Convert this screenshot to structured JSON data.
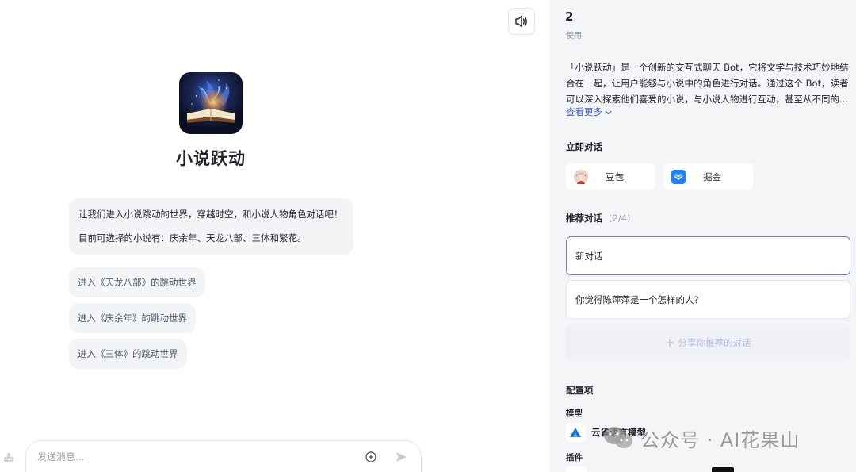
{
  "chat": {
    "bot_name": "小说跃动",
    "welcome_lines": [
      "让我们进入小说跳动的世界，穿越时空，和小说人物角色对话吧！",
      "目前可选择的小说有：庆余年、天龙八部、三体和繁花。"
    ],
    "suggestions": [
      "进入《天龙八部》的跳动世界",
      "进入《庆余年》的跳动世界",
      "进入《三体》的跳动世界"
    ],
    "composer_placeholder": "发送消息..."
  },
  "panel": {
    "usage_count": "2",
    "usage_label": "使用",
    "description": "「小说跃动」是一个创新的交互式聊天 Bot，它将文学与技术巧妙地结合在一起，让用户能够与小说中的角色进行对话。通过这个 Bot，读者可以深入探索他们喜爱的小说，与小说人物进行互动，甚至从不同的...",
    "see_more": "查看更多",
    "chat_now_title": "立即对话",
    "chat_apps": [
      {
        "label": "豆包",
        "icon": "doubao-avatar-icon"
      },
      {
        "label": "掘金",
        "icon": "juejin-logo-icon"
      }
    ],
    "recommend_title": "推荐对话",
    "recommend_count": "(2/4)",
    "recommend_items": [
      "新对话",
      "你觉得陈萍萍是一个怎样的人?"
    ],
    "share_label": "分享你推荐的对话",
    "config_title": "配置项",
    "model_label": "模型",
    "model_name": "云雀语言模型",
    "plugin_label": "插件"
  },
  "watermark": {
    "text": "公众号 · AI花果山"
  },
  "colors": {
    "accent": "#6d76e6",
    "link": "#3a5ccc",
    "panel_bg": "#f4f5f7",
    "bubble_bg": "#f3f4f6"
  }
}
